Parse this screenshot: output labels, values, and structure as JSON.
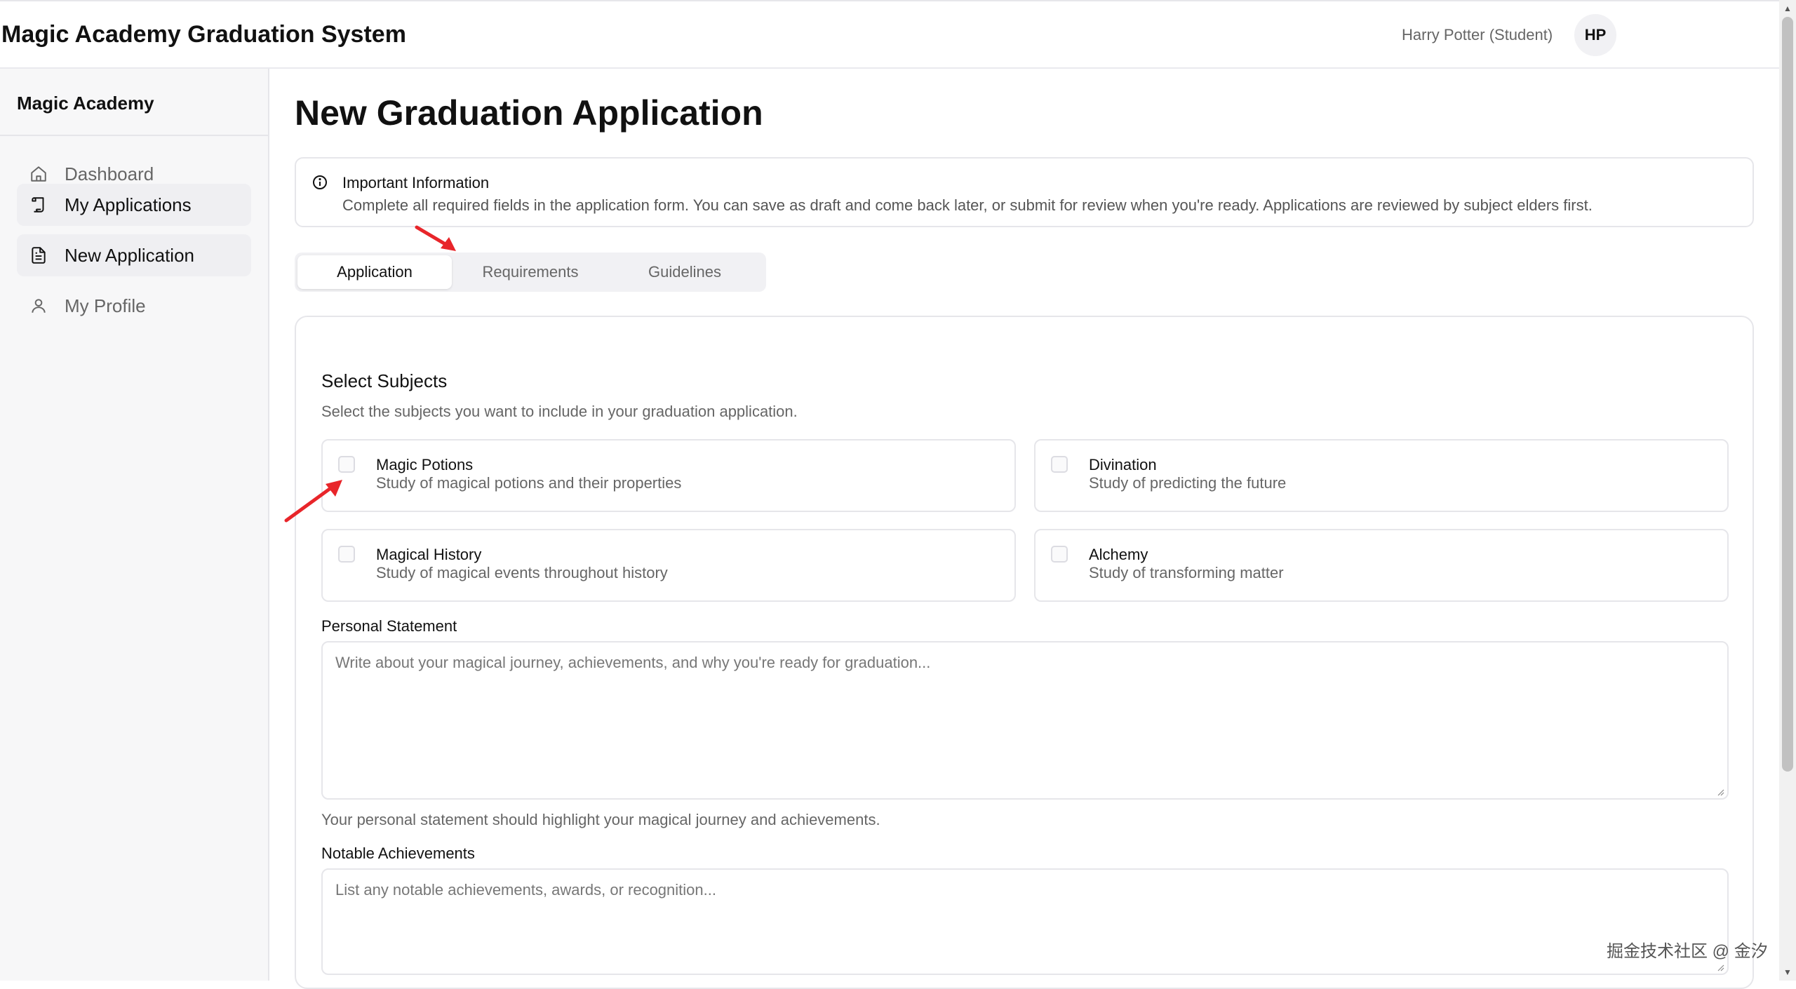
{
  "header": {
    "app_title": "Magic Academy Graduation System",
    "user_name": "Harry Potter (Student)",
    "avatar_initials": "HP"
  },
  "sidebar": {
    "brand": "Magic Academy",
    "items": [
      {
        "label": "Dashboard",
        "icon": "home-icon"
      },
      {
        "label": "My Applications",
        "icon": "scroll-icon"
      },
      {
        "label": "New Application",
        "icon": "file-text-icon"
      },
      {
        "label": "My Profile",
        "icon": "user-icon"
      }
    ]
  },
  "main": {
    "page_title": "New Graduation Application",
    "info": {
      "icon": "info-icon",
      "title": "Important Information",
      "text": "Complete all required fields in the application form. You can save as draft and come back later, or submit for review when you're ready. Applications are reviewed by subject elders first."
    },
    "tabs": [
      {
        "label": "Application",
        "active": true
      },
      {
        "label": "Requirements",
        "active": false
      },
      {
        "label": "Guidelines",
        "active": false
      }
    ],
    "subjects_section": {
      "title": "Select Subjects",
      "description": "Select the subjects you want to include in your graduation application.",
      "subjects": [
        {
          "name": "Magic Potions",
          "description": "Study of magical potions and their properties",
          "checked": false
        },
        {
          "name": "Divination",
          "description": "Study of predicting the future",
          "checked": false
        },
        {
          "name": "Magical History",
          "description": "Study of magical events throughout history",
          "checked": false
        },
        {
          "name": "Alchemy",
          "description": "Study of transforming matter",
          "checked": false
        }
      ]
    },
    "personal_statement": {
      "label": "Personal Statement",
      "placeholder": "Write about your magical journey, achievements, and why you're ready for graduation...",
      "help": "Your personal statement should highlight your magical journey and achievements."
    },
    "notable_achievements": {
      "label": "Notable Achievements",
      "placeholder": "List any notable achievements, awards, or recognition..."
    }
  },
  "watermark": "掘金技术社区 @ 金汐",
  "colors": {
    "annotation_arrow": "#e8252a",
    "sidebar_bg": "#f7f7f8",
    "border": "#e6e6ea"
  }
}
